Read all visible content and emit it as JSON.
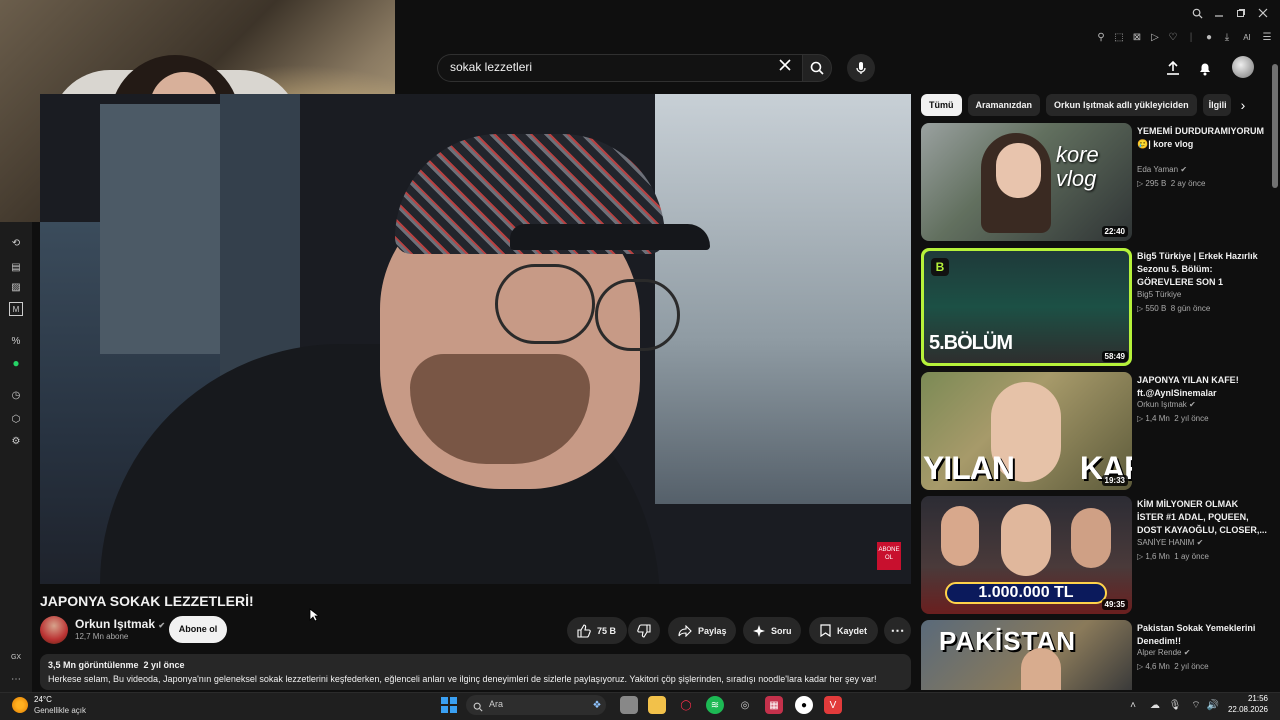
{
  "header": {
    "search_value": "sokak lezzetleri",
    "browser_ext_label": "AI"
  },
  "video": {
    "title": "JAPONYA SOKAK LEZZETLERİ!",
    "badge_text": "ABONE OL",
    "channel": {
      "name": "Orkun Işıtmak",
      "subscribers": "12,7 Mn abone",
      "subscribe_label": "Abone ol"
    },
    "actions": {
      "likes": "75 B",
      "share": "Paylaş",
      "ask": "Soru",
      "save": "Kaydet"
    },
    "description": {
      "meta": "3,5 Mn görüntülenme  2 yıl önce",
      "text": "Herkese selam, Bu videoda, Japonya'nın geleneksel sokak lezzetlerini keşfederken, eğlenceli anları ve ilginç deneyimleri de sizlerle paylaşıyoruz. Yakitori çöp şişlerinden, sıradışı noodle'lara kadar her şey var!"
    }
  },
  "chips": [
    "Tümü",
    "Aramanızdan",
    "Orkun Işıtmak adlı yükleyiciden",
    "İlgili"
  ],
  "recommendations": [
    {
      "title": "YEMEMİ DURDURAMIYORUM🥲| kore vlog",
      "channel": "Eda Yaman",
      "views": "295 B",
      "age": "2 ay önce",
      "duration": "22:40",
      "thumb_text": "kore vlog"
    },
    {
      "title": "Big5 Türkiye | Erkek Hazırlık Sezonu 5. Bölüm: GÖREVLERE SON 1",
      "channel": "Big5 Türkiye",
      "views": "550 B",
      "age": "8 gün önce",
      "duration": "58:49",
      "thumb_text": "5.BÖLÜM"
    },
    {
      "title": "JAPONYA YILAN KAFE! ft.@AynlSinemalar",
      "channel": "Orkun Işıtmak",
      "views": "1,4 Mn",
      "age": "2 yıl önce",
      "duration": "19:33",
      "thumb_text": "YILAN KAFE"
    },
    {
      "title": "KİM MİLYONER OLMAK İSTER #1 ADAL, PQUEEN, DOST KAYAOĞLU, CLOSER,...",
      "channel": "SANİYE HANIM",
      "views": "1,6 Mn",
      "age": "1 ay önce",
      "duration": "49:35",
      "thumb_text": "1.000.000 TL"
    },
    {
      "title": "Pakistan Sokak Yemeklerini Denedim!!",
      "channel": "Alper Rende",
      "views": "4,6 Mn",
      "age": "2 yıl önce",
      "duration": "",
      "thumb_text": "PAKİSTAN"
    }
  ],
  "rail_bottom_label": "GX",
  "taskbar": {
    "temperature": "24°C",
    "condition": "Genellikle açık",
    "search_placeholder": "Ara",
    "time": "21:56",
    "date": "22.08.2026"
  },
  "colors": {
    "background": "#0f0f0f",
    "chip_active": "#f1f1f1",
    "accent_green": "#b6f23a",
    "badge_red": "#c8102e"
  }
}
